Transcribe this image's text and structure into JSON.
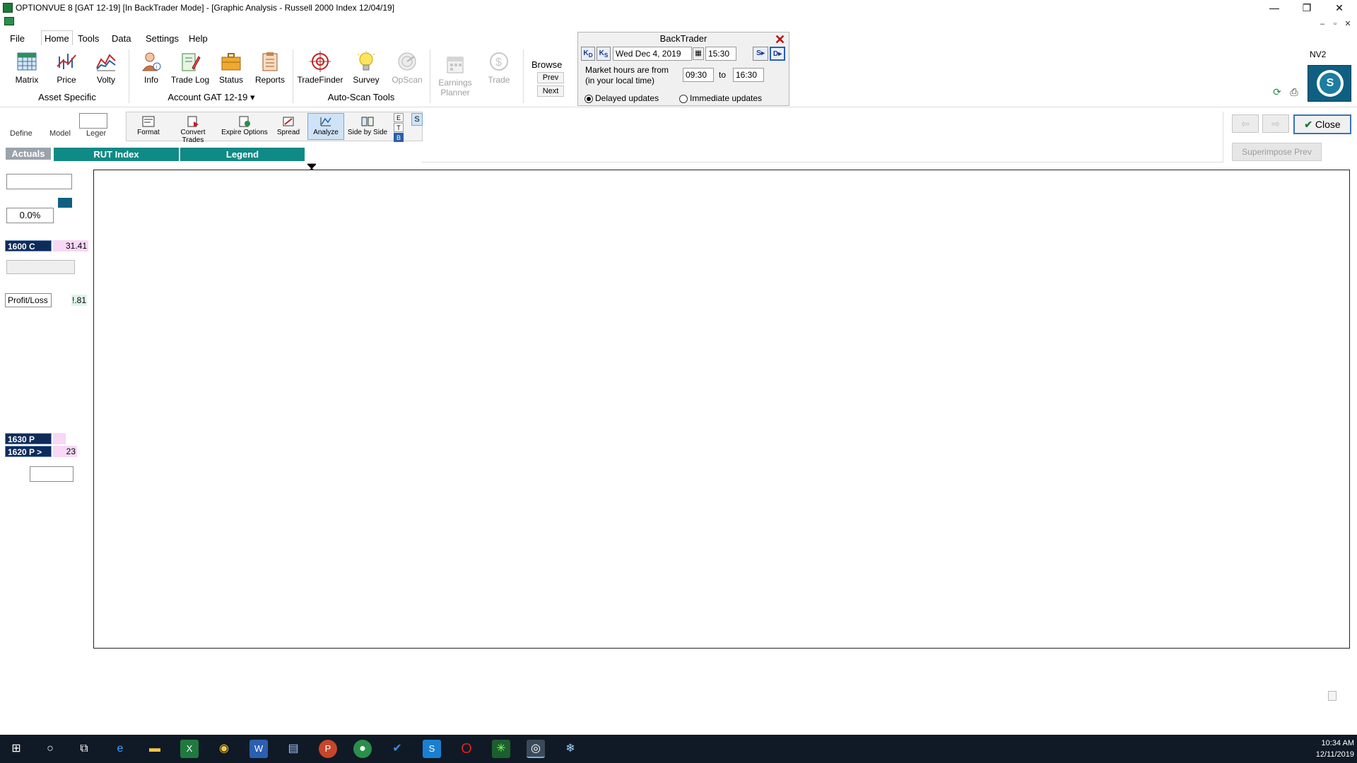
{
  "window": {
    "title": "OPTIONVUE 8   [GAT 12-19]   [In BackTrader Mode] - [Graphic Analysis - Russell 2000 Index  12/04/19]",
    "controls": {
      "minimize": "—",
      "restore": "❐",
      "close": "✕"
    }
  },
  "menu": [
    "File",
    "Home",
    "Tools",
    "Data",
    "Settings",
    "Help"
  ],
  "ribbon": {
    "buttons": [
      {
        "label": "Matrix",
        "icon": "matrix-icon"
      },
      {
        "label": "Price",
        "icon": "price-chart-icon"
      },
      {
        "label": "Volty",
        "icon": "volatility-chart-icon"
      },
      {
        "label": "Info",
        "icon": "info-person-icon"
      },
      {
        "label": "Trade Log",
        "icon": "trade-log-icon"
      },
      {
        "label": "Status",
        "icon": "briefcase-icon"
      },
      {
        "label": "Reports",
        "icon": "clipboard-icon"
      },
      {
        "label": "TradeFinder",
        "icon": "target-icon"
      },
      {
        "label": "Survey",
        "icon": "lightbulb-icon"
      },
      {
        "label": "OpScan",
        "icon": "radar-icon"
      },
      {
        "label": "Earnings",
        "label2": "Planner",
        "icon": "calendar-icon"
      },
      {
        "label": "Trade",
        "icon": "dollar-icon"
      }
    ],
    "groups": {
      "asset": "Asset Specific",
      "account": "Account GAT 12-19",
      "autoscan": "Auto-Scan Tools"
    },
    "browse": {
      "label": "Browse",
      "prev": "Prev",
      "next": "Next"
    },
    "nv2": "NV2",
    "logo_letter": "S"
  },
  "backtrader": {
    "title": "BackTrader",
    "close": "✕",
    "nav": {
      "back_day": "K",
      "back_day_sub": "D",
      "back_step": "K",
      "back_step_sub": "S",
      "fwd_step": "S",
      "fwd_day": "D"
    },
    "date": "Wed Dec 4, 2019",
    "time": "15:30",
    "market_label_1": "Market hours are from",
    "market_label_2": "(in your local time)",
    "from": "09:30",
    "to_label": "to",
    "to": "16:30",
    "radio_delayed": "Delayed updates",
    "radio_immediate": "Immediate updates"
  },
  "toolbar2": {
    "buttons": [
      "Format",
      "Convert Trades",
      "Expire Options",
      "Spread",
      "Analyze",
      "Side by Side"
    ],
    "letters": [
      "E",
      "T",
      "B"
    ],
    "s_btn": "S"
  },
  "left": {
    "tabs": [
      "Define",
      "Model",
      "Leger"
    ],
    "actuals": "Actuals",
    "pct": "0.0%",
    "legs_top": [
      {
        "name": "1600 C",
        "value": "31.41"
      }
    ],
    "profit_loss": "Profit/Loss",
    "pl_value": "!.81",
    "legs_bottom": [
      {
        "name": "1630 P",
        "value": ""
      },
      {
        "name": "1620 P >",
        "value": "23"
      }
    ]
  },
  "headers": {
    "rut": "RUT Index",
    "legend": "Legend"
  },
  "right": {
    "back_arrow": "⇦",
    "fwd_arrow": "⇨",
    "close": "Close",
    "superimpose": "Superimpose Prev"
  },
  "taskbar": {
    "time": "10:34 AM",
    "date": "12/11/2019"
  },
  "colors": {
    "accent_teal": "#0f8a86",
    "leg_navy": "#0f2b5a",
    "value_pink": "#f7d8f5",
    "taskbar": "#101a26"
  }
}
